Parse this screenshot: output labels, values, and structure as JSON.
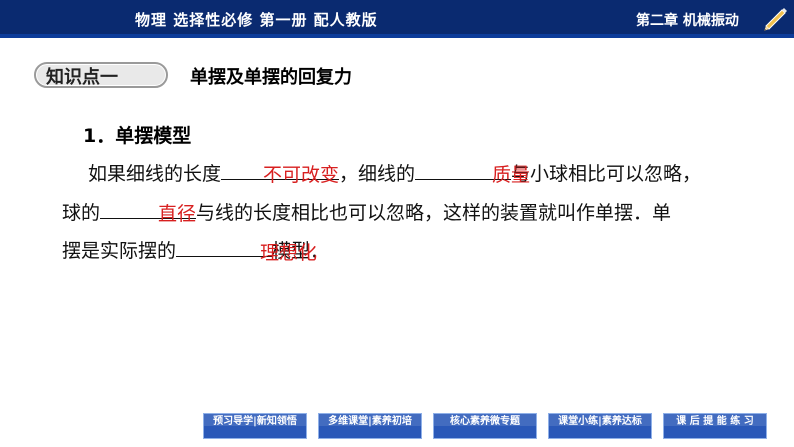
{
  "header": {
    "book_title": "物理   选择性必修   第一册   配人教版",
    "chapter": "第二章    机械振动",
    "icon": "pencil-icon"
  },
  "knowledge_point": {
    "badge": "知识点一",
    "title": "单摆及单摆的回复力"
  },
  "content": {
    "subheading": "1．单摆模型",
    "line1": {
      "part1": "如果细线的长度",
      "part2": "，细线的",
      "part3": "与小球相比可以忽略，"
    },
    "line2": {
      "part1": "球的",
      "part2": "与线的长度相比也可以忽略，这样的装置就叫作单摆．单"
    },
    "line3": {
      "part1": "摆是实际摆的",
      "part2": "模型．"
    },
    "answers": {
      "a1": "不可改变",
      "a2": "质量",
      "a3": "直径",
      "a4": "理想化"
    }
  },
  "footer": {
    "buttons": [
      {
        "label": "预习导学|新知领悟"
      },
      {
        "label": "多维课堂|素养初培"
      },
      {
        "label": "核心素养微专题"
      },
      {
        "label": "课堂小练|素养达标"
      },
      {
        "label": "课 后 提 能 练 习"
      }
    ]
  },
  "colors": {
    "header_bg": "#0a2a70",
    "answer": "#d82020",
    "button_bg": "#2a58b8"
  }
}
